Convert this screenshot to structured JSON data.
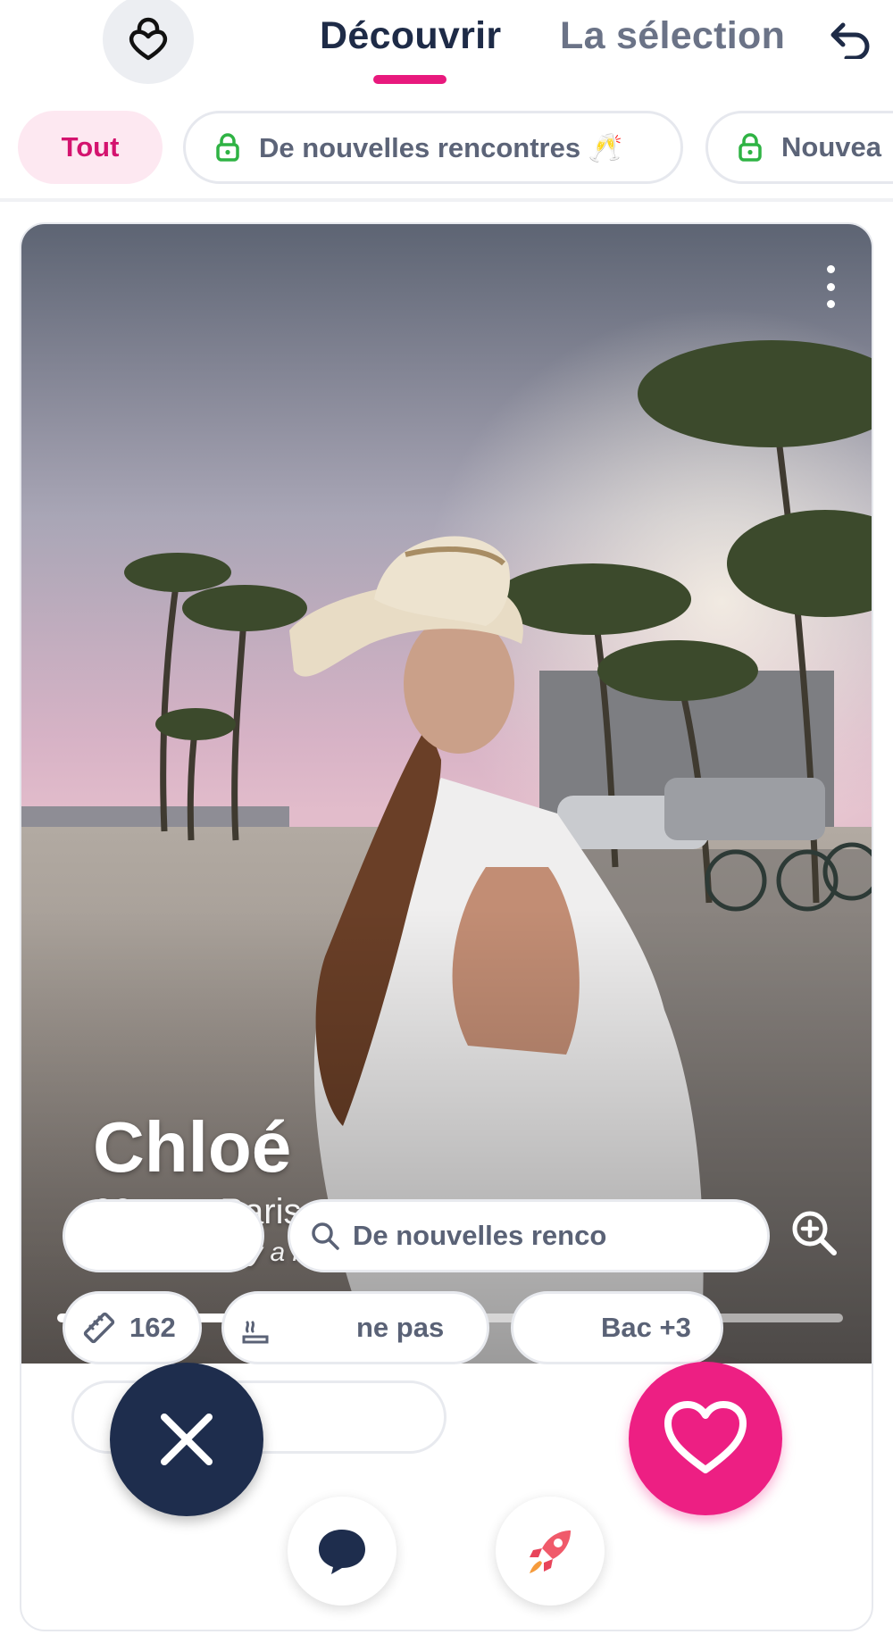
{
  "header": {
    "tabs": [
      {
        "label": "Découvrir",
        "active": true
      },
      {
        "label": "La sélection",
        "active": false
      }
    ],
    "accent_color": "#e8197d"
  },
  "filters": {
    "chips": [
      {
        "label": "Tout",
        "selected": true,
        "locked": false
      },
      {
        "label": "De nouvelles rencontres 🥂",
        "selected": false,
        "locked": true
      },
      {
        "label": "Nouvea",
        "selected": false,
        "locked": true
      }
    ]
  },
  "profile": {
    "name": "Chloé",
    "age_city": "22 ans, Paris",
    "last_seen": "Connectée il y a moins d'un mois",
    "photo_count": 4,
    "current_photo_index": 1,
    "info_pills": {
      "looking_for": "De nouvelles renco",
      "height": "162",
      "smoking": "ne pas",
      "education": "Bac +3"
    }
  },
  "actions": {
    "pass_icon": "close-icon",
    "like_icon": "heart-icon",
    "chat_icon": "chat-bubble-icon",
    "boost_icon": "rocket-icon",
    "pass_color": "#1e2d4d",
    "like_color": "#ed1f83"
  }
}
